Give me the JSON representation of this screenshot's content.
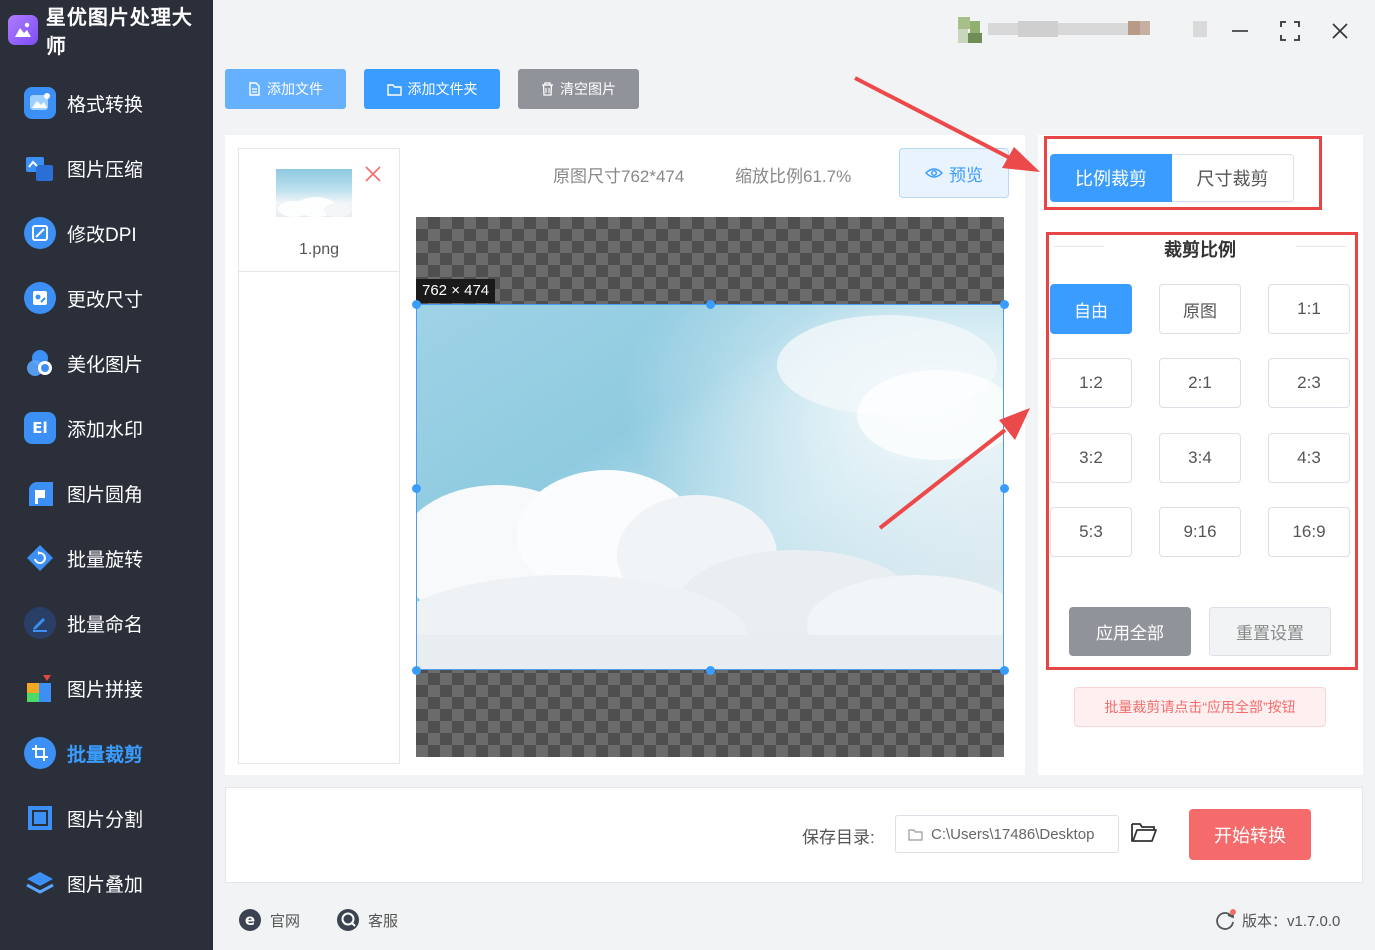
{
  "app": {
    "name": "星优图片处理大师"
  },
  "sidebar": {
    "items": [
      {
        "label": "格式转换",
        "icon": "image-convert-icon"
      },
      {
        "label": "图片压缩",
        "icon": "image-compress-icon"
      },
      {
        "label": "修改DPI",
        "icon": "dpi-icon"
      },
      {
        "label": "更改尺寸",
        "icon": "resize-icon"
      },
      {
        "label": "美化图片",
        "icon": "beautify-icon"
      },
      {
        "label": "添加水印",
        "icon": "watermark-icon"
      },
      {
        "label": "图片圆角",
        "icon": "round-corner-icon"
      },
      {
        "label": "批量旋转",
        "icon": "rotate-icon"
      },
      {
        "label": "批量命名",
        "icon": "rename-icon"
      },
      {
        "label": "图片拼接",
        "icon": "puzzle-icon"
      },
      {
        "label": "批量裁剪",
        "icon": "crop-icon",
        "active": true
      },
      {
        "label": "图片分割",
        "icon": "split-icon"
      },
      {
        "label": "图片叠加",
        "icon": "layers-icon"
      }
    ]
  },
  "toolbar": {
    "add_file": "添加文件",
    "add_folder": "添加文件夹",
    "clear": "清空图片"
  },
  "file_list": {
    "files": [
      {
        "name": "1.png"
      }
    ]
  },
  "preview": {
    "original_size": "原图尺寸762*474",
    "zoom": "缩放比例61.7%",
    "preview_button": "预览",
    "size_tag": "762 × 474"
  },
  "crop": {
    "tabs": [
      {
        "label": "比例裁剪",
        "active": true
      },
      {
        "label": "尺寸裁剪",
        "active": false
      }
    ],
    "ratio_title": "裁剪比例",
    "ratios": [
      "自由",
      "原图",
      "1:1",
      "1:2",
      "2:1",
      "2:3",
      "3:2",
      "3:4",
      "4:3",
      "5:3",
      "9:16",
      "16:9"
    ],
    "selected_ratio": "自由",
    "apply_all": "应用全部",
    "reset": "重置设置",
    "hint": "批量裁剪请点击“应用全部”按钮"
  },
  "output": {
    "save_label": "保存目录:",
    "save_path": "C:\\Users\\17486\\Desktop",
    "start_button": "开始转换"
  },
  "footer": {
    "website": "官网",
    "support": "客服",
    "version": "版本：v1.7.0.0"
  },
  "colors": {
    "accent": "#3b9cff",
    "sidebar_bg": "#2b2f3a",
    "danger": "#f56a6a",
    "annotation_red": "#e84545"
  }
}
